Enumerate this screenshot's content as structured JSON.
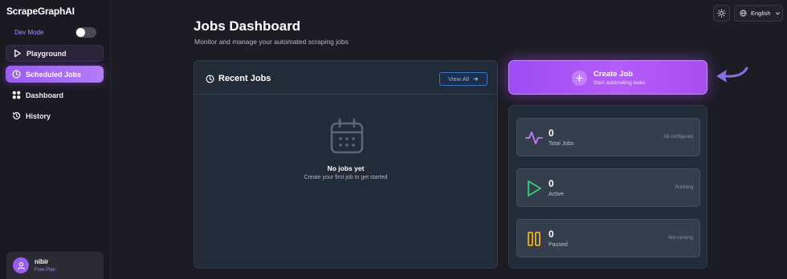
{
  "app": {
    "brand": "ScrapeGraphAI",
    "dev_mode_label": "Dev Mode",
    "dev_mode_on": false
  },
  "sidebar": {
    "items": [
      {
        "label": "Playground",
        "icon": "play-icon"
      },
      {
        "label": "Scheduled Jobs",
        "icon": "clock-icon",
        "active": true
      },
      {
        "label": "Dashboard",
        "icon": "grid-icon"
      },
      {
        "label": "History",
        "icon": "history-icon"
      }
    ]
  },
  "user": {
    "name": "nibir",
    "plan": "Free Plan"
  },
  "topbar": {
    "theme_icon": "sun-icon",
    "language": "English"
  },
  "header": {
    "title": "Jobs Dashboard",
    "subtitle": "Monitor and manage your automated scraping jobs"
  },
  "recent_jobs": {
    "title": "Recent Jobs",
    "view_all": "View All",
    "empty_title": "No jobs yet",
    "empty_subtitle": "Create your first job to get started"
  },
  "create_job": {
    "label": "Create Job",
    "subtitle": "Start automating tasks"
  },
  "stats": [
    {
      "value": "0",
      "label": "Total Jobs",
      "note": "All configured",
      "icon": "activity-icon",
      "color": "#c77dff"
    },
    {
      "value": "0",
      "label": "Active",
      "note": "Running",
      "icon": "play-icon",
      "color": "#34d27a"
    },
    {
      "value": "0",
      "label": "Paused",
      "note": "Not running",
      "icon": "pause-icon",
      "color": "#f2b21c"
    }
  ],
  "colors": {
    "accent": "#9b5cf0",
    "background": "#1c1c24",
    "card": "#222b38"
  }
}
